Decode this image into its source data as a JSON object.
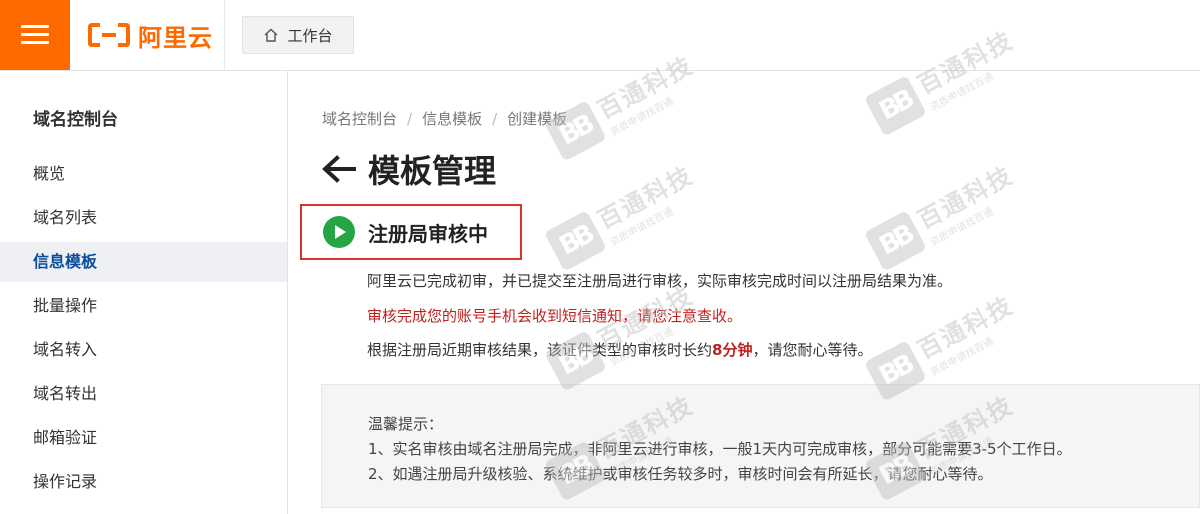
{
  "colors": {
    "brand": "#ff6a00",
    "status_green": "#26a544",
    "highlight_red": "#d9342b",
    "warning_text": "#c0211f",
    "active_nav": "#0a4d9c"
  },
  "header": {
    "menu_icon": "hamburger-menu-icon",
    "logo_text": "阿里云",
    "workbench_icon": "home-icon",
    "workbench_label": "工作台"
  },
  "sidebar": {
    "title": "域名控制台",
    "items": [
      {
        "label": "概览"
      },
      {
        "label": "域名列表"
      },
      {
        "label": "信息模板"
      },
      {
        "label": "批量操作"
      },
      {
        "label": "域名转入"
      },
      {
        "label": "域名转出"
      },
      {
        "label": "邮箱验证"
      },
      {
        "label": "操作记录"
      }
    ],
    "active": "信息模板"
  },
  "breadcrumb": {
    "items": [
      "域名控制台",
      "信息模板",
      "创建模板"
    ],
    "separator": "/"
  },
  "page": {
    "back_icon": "arrow-left-icon",
    "title": "模板管理"
  },
  "status": {
    "icon": "play-circle-icon",
    "label": "注册局审核中"
  },
  "info": {
    "line1": "阿里云已完成初审，并已提交至注册局进行审核，实际审核完成时间以注册局结果为准。",
    "line2": "审核完成您的账号手机会收到短信通知，请您注意查收。",
    "line3_pre": "根据注册局近期审核结果，该证件类型的审核时长约",
    "line3_bold": "8分钟",
    "line3_post": "，请您耐心等待。"
  },
  "tips": {
    "title": "温馨提示：",
    "items": [
      "1、实名审核由域名注册局完成，非阿里云进行审核，一般1天内可完成审核，部分可能需要3-5个工作日。",
      "2、如遇注册局升级核验、系统维护或审核任务较多时，审核时间会有所延长，请您耐心等待。"
    ]
  },
  "watermark": {
    "mark": "BB",
    "title": "百通科技",
    "subtitle": "资质申请找百通"
  }
}
